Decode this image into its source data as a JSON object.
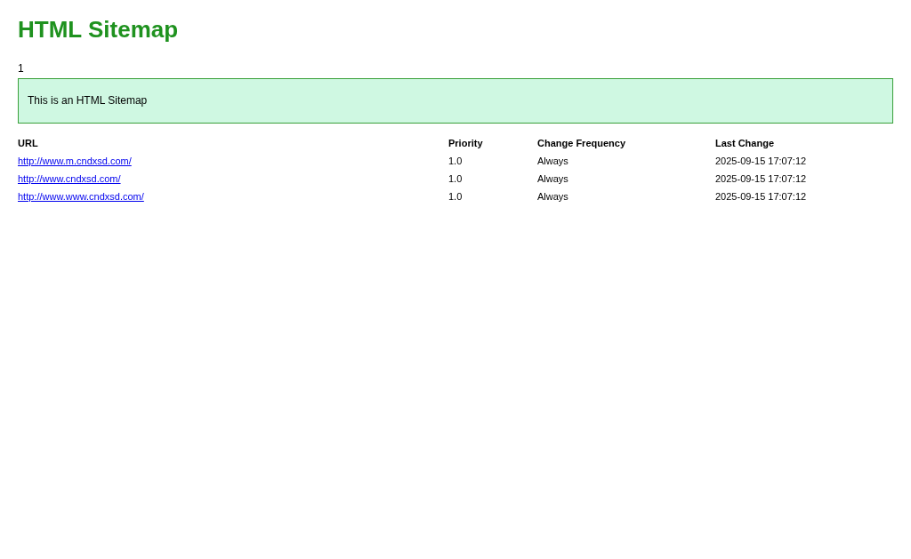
{
  "title": "HTML Sitemap",
  "page_number": "1",
  "intro": "This is an HTML Sitemap",
  "table": {
    "columns": [
      "URL",
      "Priority",
      "Change Frequency",
      "Last Change"
    ],
    "rows": [
      {
        "url": "http://www.m.cndxsd.com/",
        "priority": "1.0",
        "change_frequency": "Always",
        "last_change": "2025-09-15 17:07:12"
      },
      {
        "url": "http://www.cndxsd.com/",
        "priority": "1.0",
        "change_frequency": "Always",
        "last_change": "2025-09-15 17:07:12"
      },
      {
        "url": "http://www.www.cndxsd.com/",
        "priority": "1.0",
        "change_frequency": "Always",
        "last_change": "2025-09-15 17:07:12"
      }
    ]
  }
}
